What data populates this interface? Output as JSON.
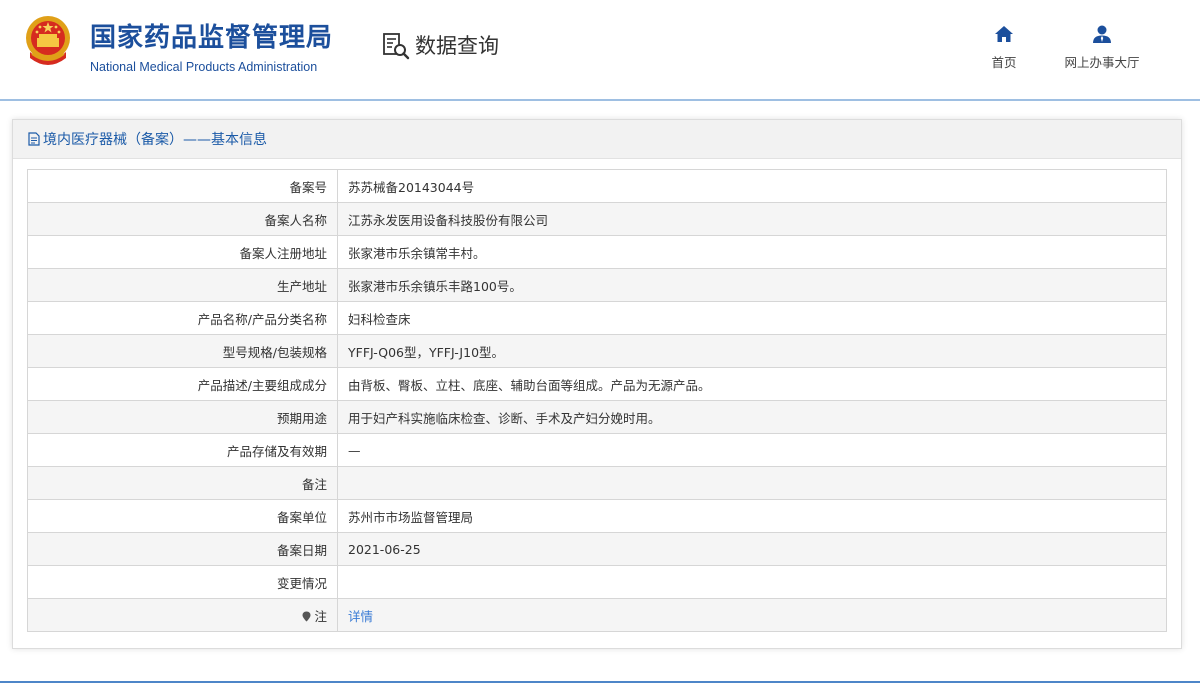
{
  "header": {
    "org_name_cn": "国家药品监督管理局",
    "org_name_en": "National Medical Products Administration",
    "query_title": "数据查询",
    "nav": {
      "home_label": "首页",
      "service_label": "网上办事大厅"
    },
    "colors": {
      "brand": "#1c4f9c",
      "rule": "#9ebfe2"
    }
  },
  "panel": {
    "title": "境内医疗器械（备案）——基本信息",
    "rows": [
      {
        "label": "备案号",
        "value": "苏苏械备20143044号"
      },
      {
        "label": "备案人名称",
        "value": "江苏永发医用设备科技股份有限公司"
      },
      {
        "label": "备案人注册地址",
        "value": "张家港市乐余镇常丰村。"
      },
      {
        "label": "生产地址",
        "value": "张家港市乐余镇乐丰路100号。"
      },
      {
        "label": "产品名称/产品分类名称",
        "value": "妇科检查床"
      },
      {
        "label": "型号规格/包装规格",
        "value": "YFFJ-Q06型，YFFJ-J10型。"
      },
      {
        "label": "产品描述/主要组成成分",
        "value": "由背板、臀板、立柱、底座、辅助台面等组成。产品为无源产品。"
      },
      {
        "label": "预期用途",
        "value": "用于妇产科实施临床检查、诊断、手术及产妇分娩时用。"
      },
      {
        "label": "产品存储及有效期",
        "value": "—"
      },
      {
        "label": "备注",
        "value": ""
      },
      {
        "label": "备案单位",
        "value": "苏州市市场监督管理局"
      },
      {
        "label": "备案日期",
        "value": "2021-06-25"
      },
      {
        "label": "变更情况",
        "value": ""
      },
      {
        "label": "注",
        "value": "详情"
      }
    ],
    "icons": {
      "title_icon": "document-icon",
      "note_icon": "pin-icon"
    },
    "link_color": "#3a7bd5"
  }
}
